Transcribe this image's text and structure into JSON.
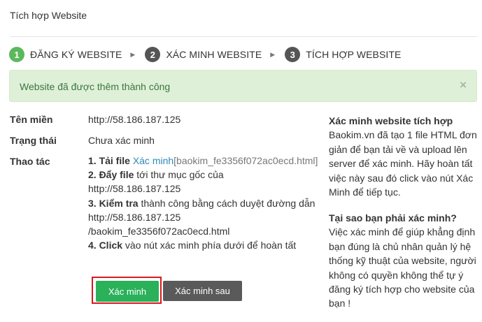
{
  "page": {
    "title": "Tích hợp Website"
  },
  "steps": [
    {
      "num": "1",
      "label": "ĐĂNG KÝ WEBSITE",
      "state": "active"
    },
    {
      "num": "2",
      "label": "XÁC MINH WEBSITE",
      "state": "inactive"
    },
    {
      "num": "3",
      "label": "TÍCH HỢP WEBSITE",
      "state": "inactive"
    }
  ],
  "alert": {
    "message": "Website đã được thêm thành công",
    "close": "×"
  },
  "fields": {
    "domain_label": "Tên miền",
    "domain_value": "http://58.186.187.125",
    "status_label": "Trạng thái",
    "status_value": "Chưa xác minh",
    "action_label": "Thao tác"
  },
  "instructions": {
    "step1_bold": "1. Tải file",
    "step1_link": "Xác minh",
    "step1_file": "[baokim_fe3356f072ac0ecd.html]",
    "step2_bold": "2. Đẩy file",
    "step2_text": "tới thư mục gốc của",
    "step2_url": "http://58.186.187.125",
    "step3_bold": "3. Kiểm tra",
    "step3_text": "thành công bằng cách duyệt đường dẫn",
    "step3_url1": "http://58.186.187.125",
    "step3_url2": "/baokim_fe3356f072ac0ecd.html",
    "step4_bold": "4. Click",
    "step4_text": "vào nút xác minh phía dưới để hoàn tất"
  },
  "buttons": {
    "verify": "Xác minh",
    "verify_later": "Xác minh sau"
  },
  "sidebar": {
    "heading1": "Xác minh website tích hợp",
    "text1": "Baokim.vn đã tạo 1 file HTML đơn giản để bạn tải về và upload lên server để xác minh. Hãy hoàn tất việc này sau đó click vào nút Xác Minh để tiếp tục.",
    "heading2": "Tại sao bạn phải xác minh?",
    "text2": "Việc xác minh để giúp khẳng định bạn đúng là chủ nhân quản lý hệ thống kỹ thuật của website, người không có quyền không thể tự ý đăng ký tích hợp cho website của bạn !"
  },
  "colors": {
    "step_active": "#5cb85c",
    "step_inactive": "#555555",
    "alert_bg": "#dff0d8",
    "verify_button": "#2ab15a",
    "later_button": "#5a5a5a",
    "highlight": "#d9181e",
    "link": "#2a8ab8"
  }
}
